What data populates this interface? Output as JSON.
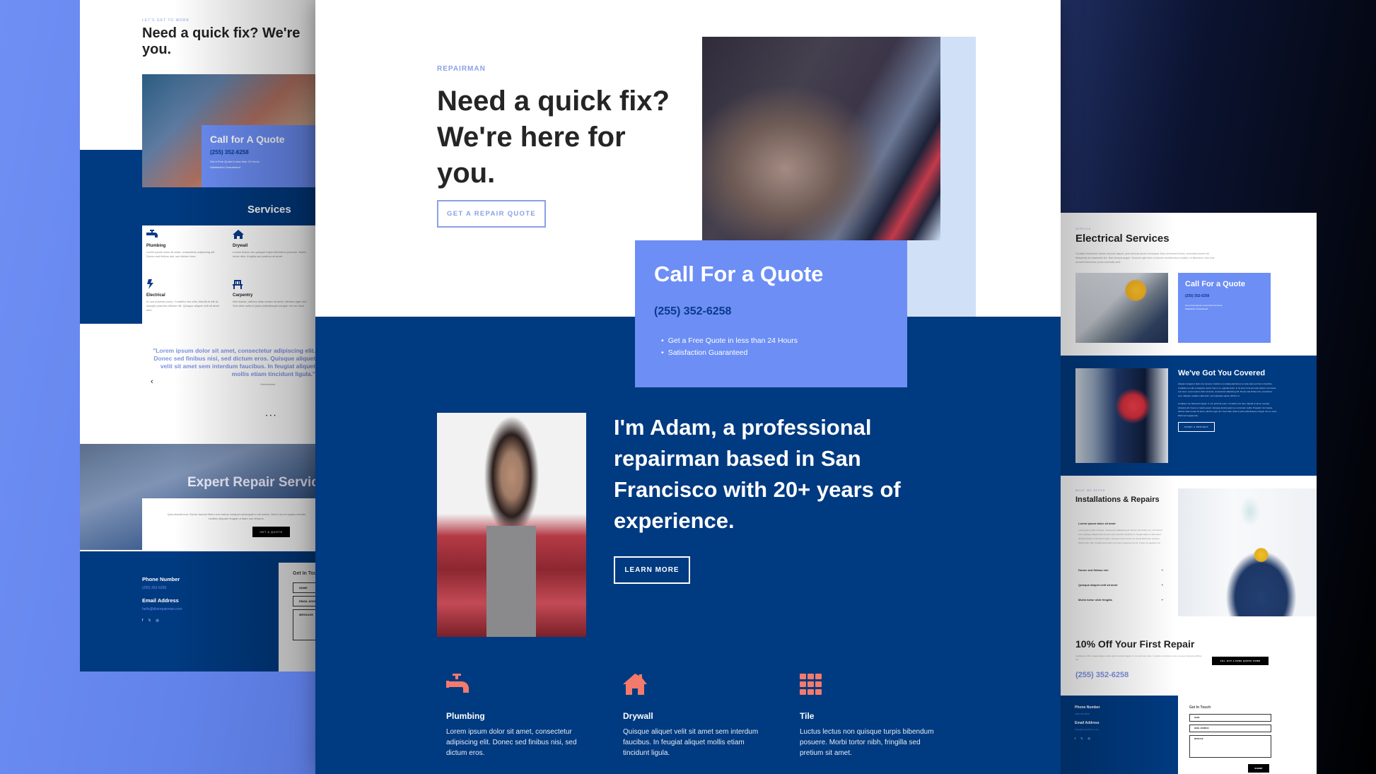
{
  "colors": {
    "navy": "#003a80",
    "accent_blue": "#6c8ef5",
    "eyebrow_blue": "#8aa0e6",
    "coral": "#f47a6b",
    "dark_text": "#252525"
  },
  "left_preview": {
    "eyebrow": "LET'S GET TO WORK",
    "title_line1": "Need a quick fix? We're",
    "title_line2": "you.",
    "quote_card": {
      "title": "Call for A Quote",
      "phone": "(255) 352-6258",
      "bullets": [
        "Get a Free Quote in less than 24 Hours",
        "Satisfaction Guaranteed"
      ]
    },
    "services_title": "Services",
    "services": [
      {
        "icon": "faucet-icon",
        "name": "Plumbing",
        "desc": "Lorem ipsum dolor sit amet, consectetur adipiscing elit. Donec sed finibus nisi, sed dictum eros."
      },
      {
        "icon": "house-icon",
        "name": "Drywall",
        "desc": "Luctus lectus non quisque turpis bibendum posuere. Morbi tortor nibh, fringilla sed pretium sit amet."
      },
      {
        "icon": "bolt-icon",
        "name": "Electrical",
        "desc": "In non pulvinar purus. Curabitur nisi odio, blandit et elit at, suscipit pharetra efficitur elit. Quisque aliquet velit sit amet sem."
      },
      {
        "icon": "chair-icon",
        "name": "Carpentry",
        "desc": "Nisl massa, ultrices vitae ornare sit amet, ultricies eget orci. Sed vitae nulla et justo pellentesque congue nec eu risus."
      }
    ],
    "testimonial": "\"Lorem ipsum dolor sit amet, consectetur adipiscing elit. Donec sed finibus nisi, sed dictum eros. Quisque aliquet velit sit amet sem interdum faucibus. In feugiat aliquet mollis etiam tincidunt ligula.\"",
    "testimonial_author": "Homeowner",
    "carousel_prev": "‹",
    "carousel_dots": "• • •",
    "expert_title": "Expert Repair Services",
    "expert_desc": "Quis blandit erat. Donec laoreet libero non metus volutpat consequat in vel metus. Sed in leo et sapien lobortis facilisis aliquam feugiat ut diam non tempus.",
    "expert_button": "GET A QUOTE",
    "footer": {
      "phone_label": "Phone Number",
      "phone": "(255) 352-6258",
      "email_label": "Email Address",
      "email": "hello@divirepairman.com"
    },
    "form": {
      "title": "Get In Touch",
      "name": "NAME",
      "email": "EMAIL ADDRESS",
      "message": "MESSAGE"
    }
  },
  "center": {
    "eyebrow": "REPAIRMAN",
    "title": "Need a quick fix? We're here for you.",
    "cta": "GET A REPAIR QUOTE",
    "quote_card": {
      "title": "Call For a Quote",
      "phone": "(255) 352-6258",
      "bullets": [
        "Get a Free Quote in less than 24 Hours",
        "Satisfaction Guaranteed"
      ]
    },
    "about": "I'm Adam, a professional repairman based in San Francisco with 20+ years of experience.",
    "learn_more": "LEARN MORE",
    "features": [
      {
        "icon": "faucet-icon",
        "name": "Plumbing",
        "desc": "Lorem ipsum dolor sit amet, consectetur adipiscing elit. Donec sed finibus nisi, sed dictum eros."
      },
      {
        "icon": "house-icon",
        "name": "Drywall",
        "desc": "Quisque aliquet velit sit amet sem interdum faucibus. In feugiat aliquet mollis etiam tincidunt ligula."
      },
      {
        "icon": "tile-grid-icon",
        "name": "Tile",
        "desc": "Luctus lectus non quisque turpis bibendum posuere. Morbi tortor nibh, fringilla sed pretium sit amet."
      }
    ]
  },
  "right_preview": {
    "eyebrow": "SERVICE",
    "title": "Electrical Services",
    "desc": "Curabitur fermentum iaculis est justo aliquet, quis vehicula ipsum consequat. Duis ut hendrerit tellus, venenatis laoreet elit. Maecenas at consectetur leo. Nam tempus augue. Vivamus eget dolor vel ipsum condimentum sodales, et bibendum odio eros sit amet fermentum purus venenatis ante.",
    "quote_card": {
      "title": "Call For a Quote",
      "phone": "(255) 352-6258",
      "bullets": [
        "Get a Free Quote in less than 24 Hours",
        "Satisfaction Guaranteed"
      ]
    },
    "covered_title": "We've Got You Covered",
    "covered_desc1": "Aliquam feugiat ut diam non tempus. Interdum et malesuada fames ac ante ipsum primis in faucibus. Curabitur ac odio consequat, auctor risus non, egestas dolor. In sit amet urna at metus dictum commodo a at nunc. Lorem ipsum dolor sit amet, consectetur adipiscing elit. Donec sed finibus nisi, sed dictum eros. Aliquam sodales nulla dolor, sed vulputate sapien efficitur ut.",
    "covered_desc2": "Curabitur non bibendum ligula. In non pulvinar purus. Curabitur nisi odio, blandit et elit at, suscipit pharetra elit. Fusce ut mauris quam. Quisque lacinia quam eu commodo mollis. Praesent nisl massa, ultrices vitae ornare sit amet, ultricies eget orci. Sed vitae nulla et justo pellentesque congue nec eu risus. Morbi ac feugiat ante.",
    "covered_button": "START A PROJECT",
    "install_eyebrow": "WHAT WE OFFER",
    "install_title": "Installations & Repairs",
    "accordion_open_title": "Lorem ipsum dolor sit amet",
    "accordion_open_body": "Lorem ipsum dolor sit amet, consectetur adipiscing elit. Donec sed finibus nisi, sed dictum eros. Quisque aliquet velit sit amet sem interdum faucibus. In feugiat aliquet mollis etiam tincidunt ligula, id hendrerit neque. Quisque luctus lectus non turpis bibendum posuere. Morbi tortor nibh, fringilla sed pretium sit amet, pharetra non est. Fusce vel egestas nisl.",
    "accordion": [
      "Donec sed finibus nisi",
      "Quisque aliquet velit sit amet",
      "Morbi tortor nibh fringilla"
    ],
    "accordion_icon": "+",
    "promo_title": "10% Off Your First Repair",
    "promo_desc": "Vestibulum nibh, feugiat aliquet mollis etiam tincidunt ligula. In non pulvinar purus. Curabitur vel dictum eros a semper pharetra efficitur elit.",
    "promo_button": "FILL OUT A FREE QUOTE FORM",
    "promo_phone": "(255) 352-6258",
    "footer": {
      "phone_label": "Phone Number",
      "phone": "(255) 352-6258",
      "email_label": "Email Address",
      "email": "hello@divirepairman.com"
    },
    "form": {
      "title": "Get In Touch",
      "name": "NAME",
      "email": "EMAIL ADDRESS",
      "message": "MESSAGE",
      "submit": "SUBMIT"
    }
  },
  "social": {
    "facebook": "f",
    "x": "𝕏",
    "instagram": "◎"
  }
}
